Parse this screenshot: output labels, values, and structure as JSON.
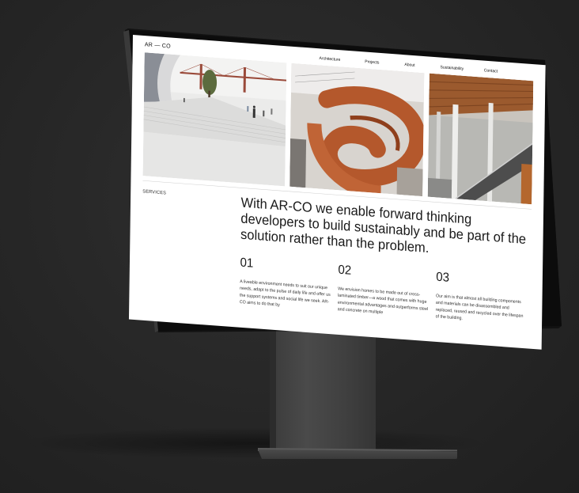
{
  "site": {
    "logo": "AR — CO",
    "nav": [
      {
        "id": "architecture",
        "label": "Architecture"
      },
      {
        "id": "projects",
        "label": "Projects"
      },
      {
        "id": "about",
        "label": "About"
      },
      {
        "id": "sustainability",
        "label": "Sustainability"
      },
      {
        "id": "contact",
        "label": "Contact"
      }
    ]
  },
  "hero": {
    "images": [
      {
        "name": "plaza-photo",
        "subject": "white architecture plaza with bridge"
      },
      {
        "name": "staircase-photo",
        "subject": "spiral timber staircase"
      },
      {
        "name": "atrium-photo",
        "subject": "timber ceiling atrium with escalators"
      }
    ]
  },
  "services": {
    "label": "SERVICES",
    "headline": "With AR-CO we enable forward thinking developers to build sustainably and be part of the solution rather than the problem.",
    "steps": [
      {
        "number": "01",
        "text": "A liveable environment needs to suit our unique needs, adapt to the pulse of daily life and offer us the support systems and social life we seek. AR-CO aims to do that by"
      },
      {
        "number": "02",
        "text": "We envision homes to be made out of cross-laminated timber—a wood that comes with huge environmental advantages and outperforms steel and concrete on multiple"
      },
      {
        "number": "03",
        "text": "Our aim is that almost all building components and materials can be disassembled and replaced, reused and recycled over the lifespan of the building."
      }
    ]
  },
  "colors": {
    "background": "#262626",
    "screen": "#ffffff",
    "wood": "#b4582c",
    "text": "#1a1a1a"
  }
}
